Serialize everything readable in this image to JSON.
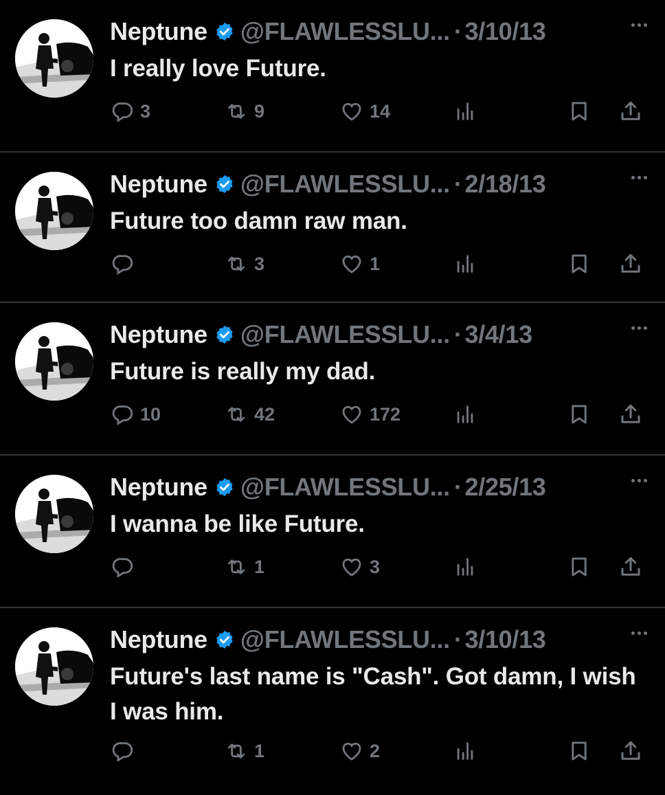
{
  "colors": {
    "background": "#000000",
    "text": "#e7e9ea",
    "muted": "#71767b",
    "verified": "#1d9bf0",
    "divider": "#2f3336"
  },
  "icons": {
    "reply": "reply-icon",
    "retweet": "retweet-icon",
    "like": "heart-icon",
    "views": "analytics-icon",
    "bookmark": "bookmark-icon",
    "share": "share-icon",
    "verified": "verified-badge-icon",
    "more": "more-options-icon"
  },
  "tweets": [
    {
      "name": "Neptune",
      "handle": "@FLAWLESSLU...",
      "dot": "·",
      "date": "3/10/13",
      "text": "I really love Future.",
      "replies": "3",
      "retweets": "9",
      "likes": "14"
    },
    {
      "name": "Neptune",
      "handle": "@FLAWLESSLU...",
      "dot": "·",
      "date": "2/18/13",
      "text": "Future too damn raw man.",
      "replies": "",
      "retweets": "3",
      "likes": "1"
    },
    {
      "name": "Neptune",
      "handle": "@FLAWLESSLU...",
      "dot": "·",
      "date": "3/4/13",
      "text": "Future is really my dad.",
      "replies": "10",
      "retweets": "42",
      "likes": "172"
    },
    {
      "name": "Neptune",
      "handle": "@FLAWLESSLU...",
      "dot": "·",
      "date": "2/25/13",
      "text": "I wanna be like Future.",
      "replies": "",
      "retweets": "1",
      "likes": "3"
    },
    {
      "name": "Neptune",
      "handle": "@FLAWLESSLU...",
      "dot": "·",
      "date": "3/10/13",
      "text": "Future's last name is \"Cash\". Got damn, I wish I was him.",
      "replies": "",
      "retweets": "1",
      "likes": "2"
    }
  ]
}
